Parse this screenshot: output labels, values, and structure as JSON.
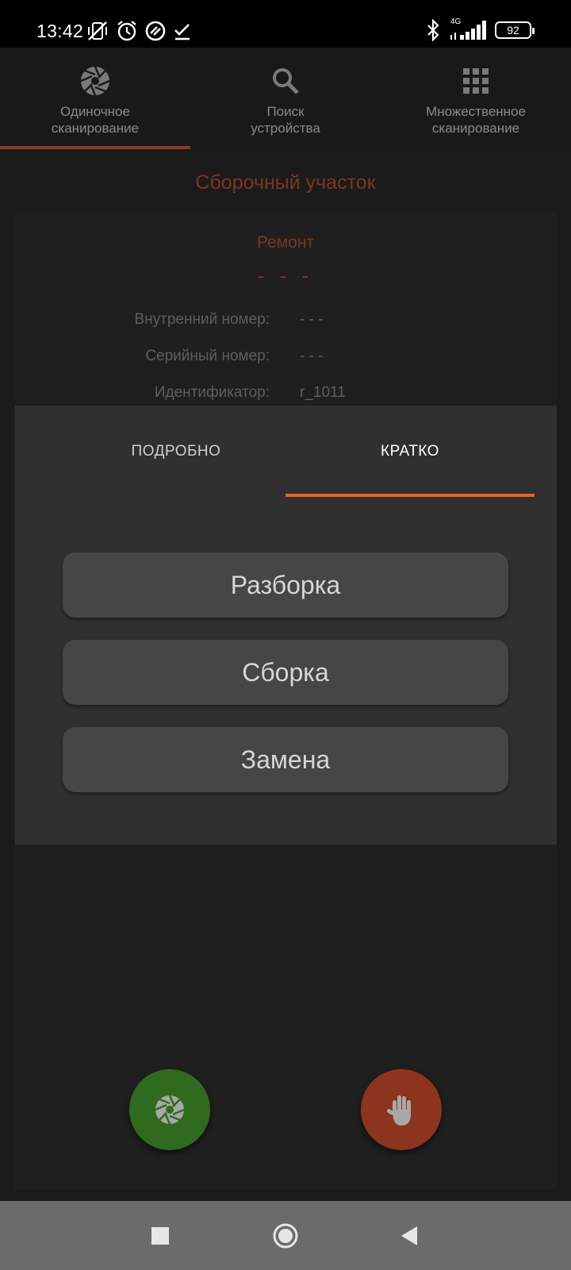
{
  "status_bar": {
    "time": "13:42",
    "network": "4G",
    "battery": "92"
  },
  "top_tabs": [
    {
      "label": "Одиночное\nсканирование",
      "icon": "shutter-icon",
      "active": true
    },
    {
      "label": "Поиск\nустройства",
      "icon": "search-icon",
      "active": false
    },
    {
      "label": "Множественное\nсканирование",
      "icon": "grid-icon",
      "active": false
    }
  ],
  "section_title": "Сборочный участок",
  "card": {
    "title": "Ремонт",
    "dash": "- - -",
    "rows": [
      {
        "label": "Внутренний номер:",
        "value": "- - -"
      },
      {
        "label": "Серийный номер:",
        "value": "- - -"
      },
      {
        "label": "Идентификатор:",
        "value": "r_1011"
      }
    ]
  },
  "dialog": {
    "tabs": [
      {
        "label": "ПОДРОБНО",
        "active": false
      },
      {
        "label": "КРАТКО",
        "active": true
      }
    ],
    "actions": [
      "Разборка",
      "Сборка",
      "Замена"
    ]
  },
  "fabs": {
    "scan_icon": "shutter-icon",
    "stop_icon": "hand-icon"
  },
  "colors": {
    "accent": "#ef5d32",
    "title_red": "#7e3422",
    "scan_green": "#2f6a1f",
    "stop_red": "#8d341f"
  }
}
